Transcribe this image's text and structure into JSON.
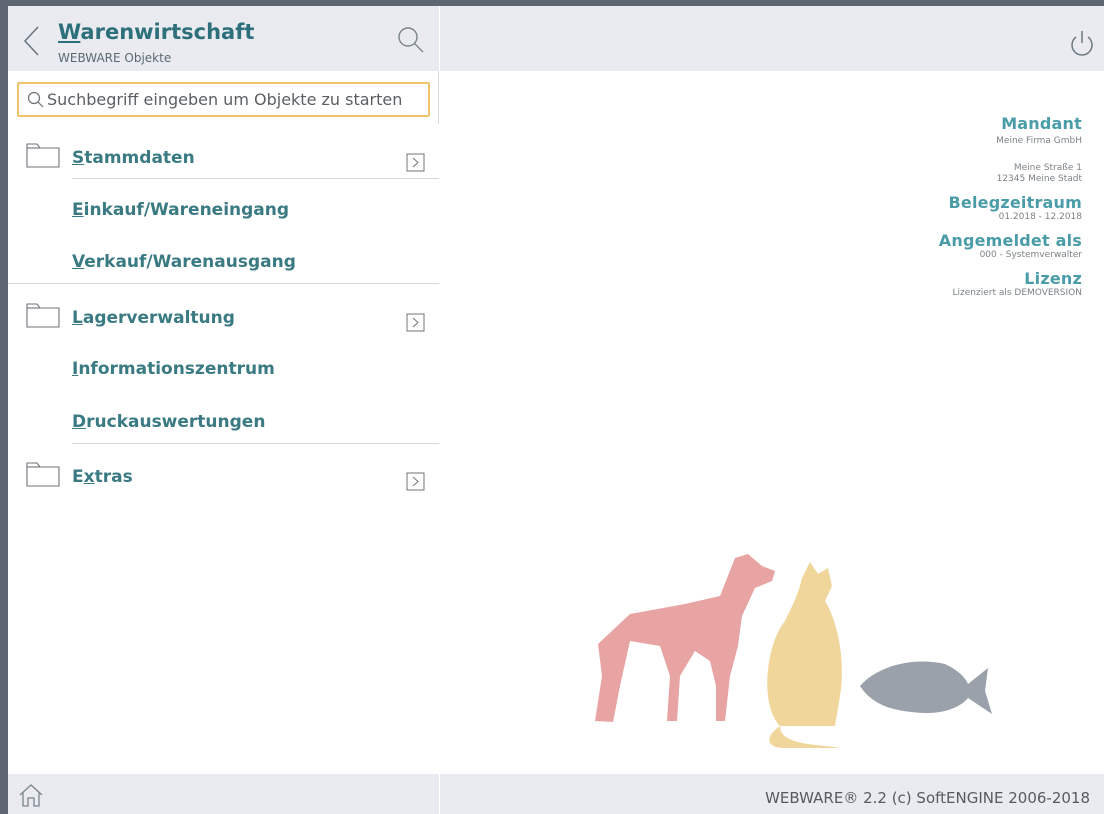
{
  "header": {
    "title_accel": "W",
    "title_rest": "arenwirtschaft",
    "subtitle": "WEBWARE Objekte"
  },
  "search": {
    "placeholder": "Suchbegriff eingeben um Objekte zu starten",
    "value": ""
  },
  "menu": {
    "stammdaten": {
      "accel": "S",
      "rest": "tammdaten"
    },
    "einkauf": {
      "accel": "E",
      "rest": "inkauf/Wareneingang"
    },
    "verkauf": {
      "accel": "V",
      "rest": "erkauf/Warenausgang"
    },
    "lager": {
      "accel": "L",
      "rest": "agerverwaltung"
    },
    "info": {
      "accel": "I",
      "rest": "nformationszentrum"
    },
    "druck": {
      "accel": "D",
      "rest": "ruckauswertungen"
    },
    "extras": {
      "pre": "E",
      "accel": "x",
      "rest": "tras"
    }
  },
  "info": {
    "mandant_label": "Mandant",
    "mandant_name": "Meine Firma GmbH",
    "street": "Meine Straße 1",
    "city": "12345 Meine Stadt",
    "period_label": "Belegzeitraum",
    "period_value": "01.2018 - 12.2018",
    "user_label": "Angemeldet als",
    "user_value": "000 - Systemverwalter",
    "license_label": "Lizenz",
    "license_value": "Lizenziert als DEMOVERSION"
  },
  "footer": {
    "copyright": "WEBWARE® 2.2 (c) SoftENGINE 2006-2018"
  },
  "colors": {
    "accent": "#3a7a83",
    "info_heading": "#4a9da8",
    "search_border": "#f0c36c",
    "header_bg": "#e9ebf1",
    "dog": "#e8a3a3",
    "cat": "#f0d69a",
    "fish": "#9aa1aa"
  },
  "icons": [
    "back-chevron-icon",
    "search-icon",
    "power-icon",
    "folder-icon",
    "chevron-right-box-icon",
    "home-icon"
  ]
}
